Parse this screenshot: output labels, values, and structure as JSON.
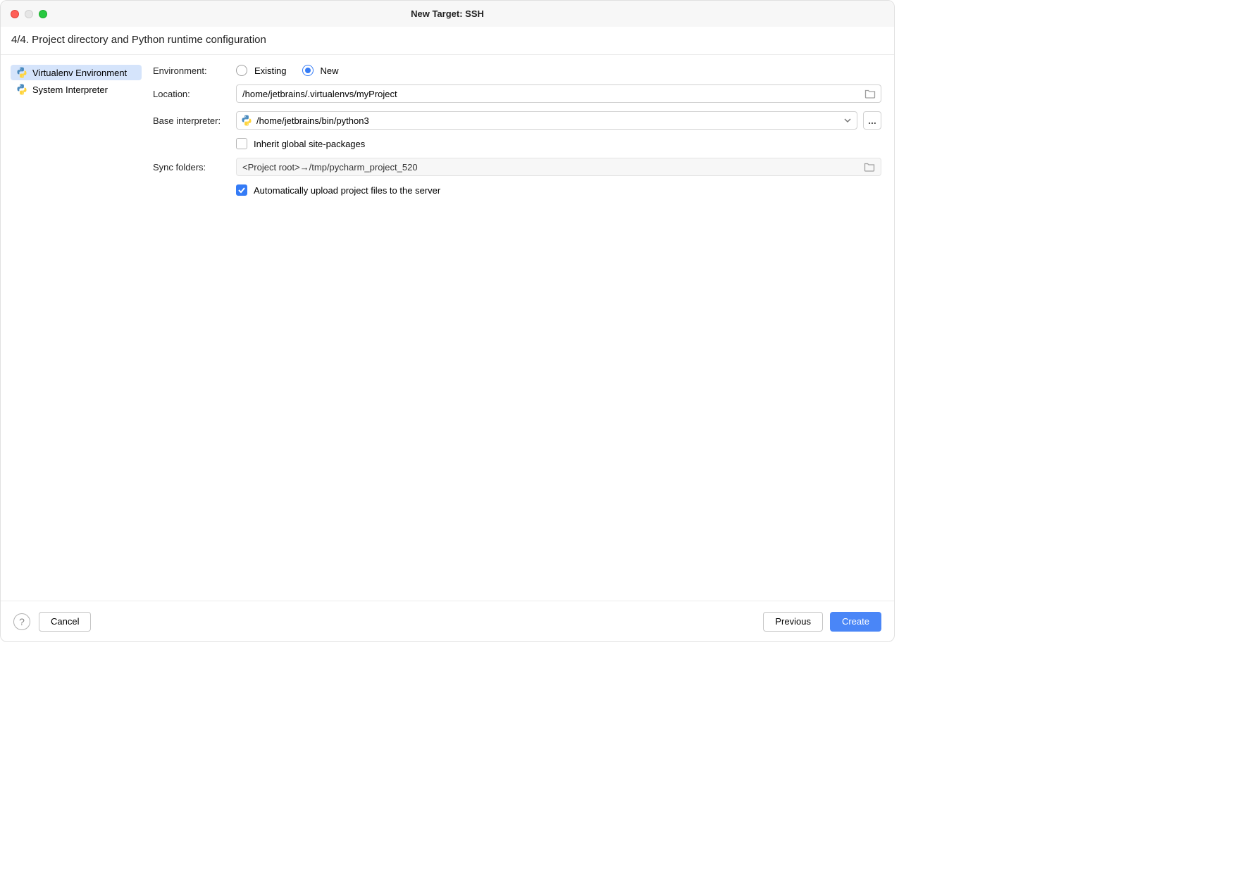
{
  "window": {
    "title": "New Target: SSH"
  },
  "step": {
    "text": "4/4. Project directory and Python runtime configuration"
  },
  "sidebar": {
    "items": [
      {
        "label": "Virtualenv Environment",
        "selected": true
      },
      {
        "label": "System Interpreter",
        "selected": false
      }
    ]
  },
  "form": {
    "environment_label": "Environment:",
    "radio_existing": "Existing",
    "radio_new": "New",
    "location_label": "Location:",
    "location_value": "/home/jetbrains/.virtualenvs/myProject",
    "base_interpreter_label": "Base interpreter:",
    "base_interpreter_value": "/home/jetbrains/bin/python3",
    "inherit_label": "Inherit global site-packages",
    "sync_label": "Sync folders:",
    "sync_value": "<Project root>→/tmp/pycharm_project_520",
    "auto_upload_label": "Automatically upload project files to the server",
    "more_button": "..."
  },
  "footer": {
    "help": "?",
    "cancel": "Cancel",
    "previous": "Previous",
    "create": "Create"
  }
}
